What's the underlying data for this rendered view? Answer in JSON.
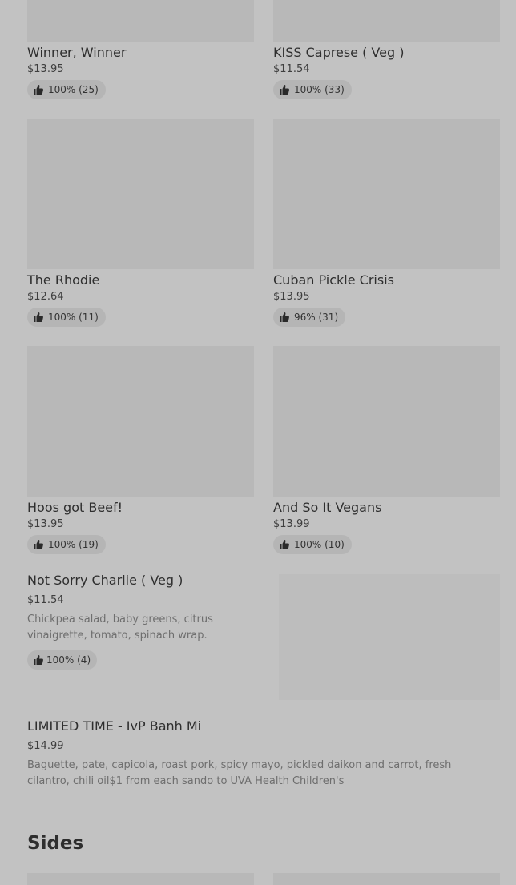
{
  "grid": [
    {
      "name": "Winner, Winner",
      "price": "$13.95",
      "rating": "100% (25)"
    },
    {
      "name": "KISS Caprese ( Veg )",
      "price": "$11.54",
      "rating": "100% (33)"
    },
    {
      "name": "The Rhodie",
      "price": "$12.64",
      "rating": "100% (11)"
    },
    {
      "name": "Cuban Pickle Crisis",
      "price": "$13.95",
      "rating": "96% (31)"
    },
    {
      "name": "Hoos got Beef!",
      "price": "$13.95",
      "rating": "100% (19)"
    },
    {
      "name": "And So It Vegans",
      "price": "$13.99",
      "rating": "100% (10)"
    }
  ],
  "list": [
    {
      "name": "Not Sorry Charlie ( Veg )",
      "price": "$11.54",
      "description": "Chickpea salad, baby greens, citrus vinaigrette, tomato, spinach wrap.",
      "rating": "100% (4)"
    },
    {
      "name": "LIMITED TIME - IvP Banh Mi",
      "price": "$14.99",
      "description": "Baguette, pate, capicola, roast pork, spicy mayo, pickled daikon and carrot, fresh cilantro, chili oil$1 from each sando to UVA Health Children's"
    }
  ],
  "sections": {
    "sides": "Sides"
  },
  "icons": {
    "rating": "thumbs-up-icon"
  },
  "colors": {
    "background": "#c2c2c2",
    "placeholder": "#b8b8b8",
    "badge": "#b5b5b5"
  }
}
